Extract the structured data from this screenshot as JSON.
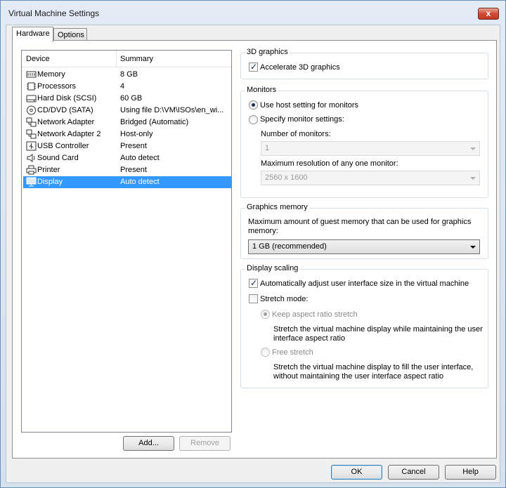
{
  "window": {
    "title": "Virtual Machine Settings",
    "close_glyph": "x"
  },
  "tabs": [
    {
      "label": "Hardware"
    },
    {
      "label": "Options"
    }
  ],
  "device_list": {
    "columns": {
      "device": "Device",
      "summary": "Summary"
    },
    "rows": [
      {
        "device": "Memory",
        "summary": "8 GB",
        "icon": "memory-icon"
      },
      {
        "device": "Processors",
        "summary": "4",
        "icon": "processor-icon"
      },
      {
        "device": "Hard Disk (SCSI)",
        "summary": "60 GB",
        "icon": "hard-disk-icon"
      },
      {
        "device": "CD/DVD (SATA)",
        "summary": "Using file D:\\VM\\ISOs\\en_wi...",
        "icon": "cd-dvd-icon"
      },
      {
        "device": "Network Adapter",
        "summary": "Bridged (Automatic)",
        "icon": "network-adapter-icon"
      },
      {
        "device": "Network Adapter 2",
        "summary": "Host-only",
        "icon": "network-adapter-icon"
      },
      {
        "device": "USB Controller",
        "summary": "Present",
        "icon": "usb-icon"
      },
      {
        "device": "Sound Card",
        "summary": "Auto detect",
        "icon": "speaker-icon"
      },
      {
        "device": "Printer",
        "summary": "Present",
        "icon": "printer-icon"
      },
      {
        "device": "Display",
        "summary": "Auto detect",
        "icon": "display-icon",
        "selected": true
      }
    ],
    "add_label": "Add...",
    "remove_label": "Remove"
  },
  "graphics3d": {
    "title": "3D graphics",
    "accelerate_label": "Accelerate 3D graphics",
    "accelerate_checked": true
  },
  "monitors": {
    "title": "Monitors",
    "use_host_label": "Use host setting for monitors",
    "specify_label": "Specify monitor settings:",
    "number_label": "Number of monitors:",
    "number_value": "1",
    "max_res_label": "Maximum resolution of any one monitor:",
    "max_res_value": "2560 x 1600"
  },
  "graphics_memory": {
    "title": "Graphics memory",
    "description": "Maximum amount of guest memory that can be used for graphics memory:",
    "value": "1 GB (recommended)"
  },
  "display_scaling": {
    "title": "Display scaling",
    "auto_adjust_label": "Automatically adjust user interface size in the virtual machine",
    "auto_adjust_checked": true,
    "stretch_label": "Stretch mode:",
    "stretch_checked": false,
    "keep_aspect_label": "Keep aspect ratio stretch",
    "keep_aspect_desc": "Stretch the virtual machine display while maintaining the user interface aspect ratio",
    "free_stretch_label": "Free stretch",
    "free_stretch_desc": "Stretch the virtual machine display to fill the user interface, without maintaining the user interface aspect ratio"
  },
  "footer": {
    "ok_label": "OK",
    "cancel_label": "Cancel",
    "help_label": "Help"
  }
}
